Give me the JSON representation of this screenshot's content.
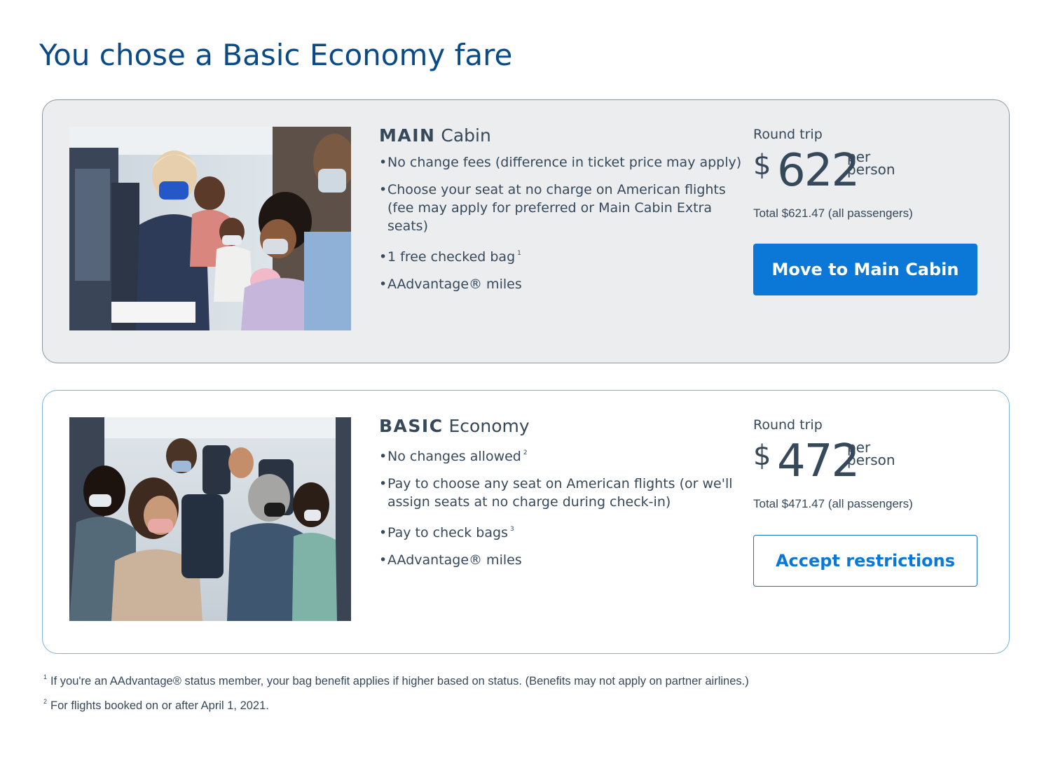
{
  "page": {
    "title": "You chose a Basic Economy fare"
  },
  "fares": {
    "main": {
      "title_bold": "MAIN",
      "title_rest": " Cabin",
      "features": [
        {
          "text": "No change fees (difference in ticket price may apply)",
          "note": ""
        },
        {
          "text": "Choose your seat at no charge on American flights (fee may apply for preferred or Main Cabin Extra seats)",
          "note": ""
        },
        {
          "text": "1 free checked bag",
          "note": "1"
        },
        {
          "text": "AAdvantage® miles",
          "note": ""
        }
      ],
      "trip_type": "Round trip",
      "currency": "$",
      "price": "622",
      "per_line1": "per",
      "per_line2": "person",
      "total": "Total $621.47 (all passengers)",
      "button": "Move to Main Cabin"
    },
    "basic": {
      "title_bold": "BASIC",
      "title_rest": " Economy",
      "features": [
        {
          "text": "No changes allowed",
          "note": "2"
        },
        {
          "text": "Pay to choose any seat on American flights (or we'll assign seats at no charge during check-in)",
          "note": ""
        },
        {
          "text": "Pay to check bags",
          "note": "3"
        },
        {
          "text": "AAdvantage® miles",
          "note": ""
        }
      ],
      "trip_type": "Round trip",
      "currency": "$",
      "price": "472",
      "per_line1": "per",
      "per_line2": "person",
      "total": "Total $471.47 (all passengers)",
      "button": "Accept restrictions"
    }
  },
  "footnotes": [
    {
      "mark": "1",
      "text": "If you're an AAdvantage® status member, your bag benefit applies if higher based on status. (Benefits may not apply on partner airlines.)"
    },
    {
      "mark": "2",
      "text": "For flights booked on or after April 1, 2021."
    }
  ]
}
